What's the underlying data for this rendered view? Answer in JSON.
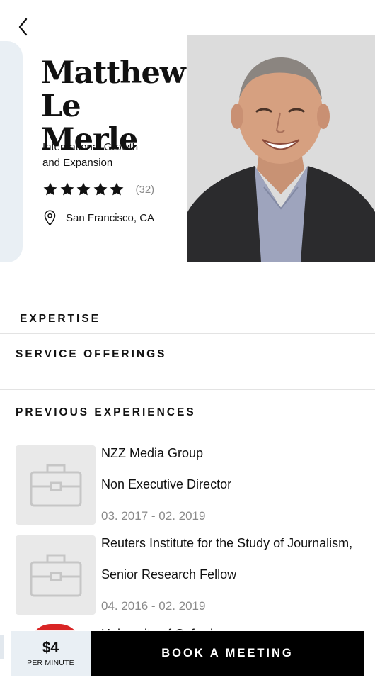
{
  "profile": {
    "first_name": "Matthew",
    "last_name": "Le Merle",
    "title_line1": "International Growth",
    "title_line2": "and Expansion",
    "rating_stars": 5,
    "rating_count": "(32)",
    "location": "San Francisco, CA"
  },
  "sections": {
    "expertise": "EXPERTISE",
    "service_offerings": "SERVICE OFFERINGS",
    "previous_experiences": "PREVIOUS EXPERIENCES"
  },
  "experiences": [
    {
      "company": "NZZ Media Group",
      "role": "Non Executive Director",
      "dates": "03. 2017 - 02. 2019",
      "icon": "briefcase-icon"
    },
    {
      "company": "Reuters Institute for the Study of Journalism,",
      "role": "Senior Research Fellow",
      "dates": "04. 2016 - 02. 2019",
      "icon": "briefcase-icon"
    }
  ],
  "partial_experience": {
    "company": "University of Oxford"
  },
  "footer": {
    "price": "$4",
    "price_unit": "PER MINUTE",
    "book_label": "BOOK A MEETING"
  },
  "colors": {
    "accent_light": "#e9eff4",
    "button": "#000000",
    "muted_text": "#8a8a8a"
  }
}
